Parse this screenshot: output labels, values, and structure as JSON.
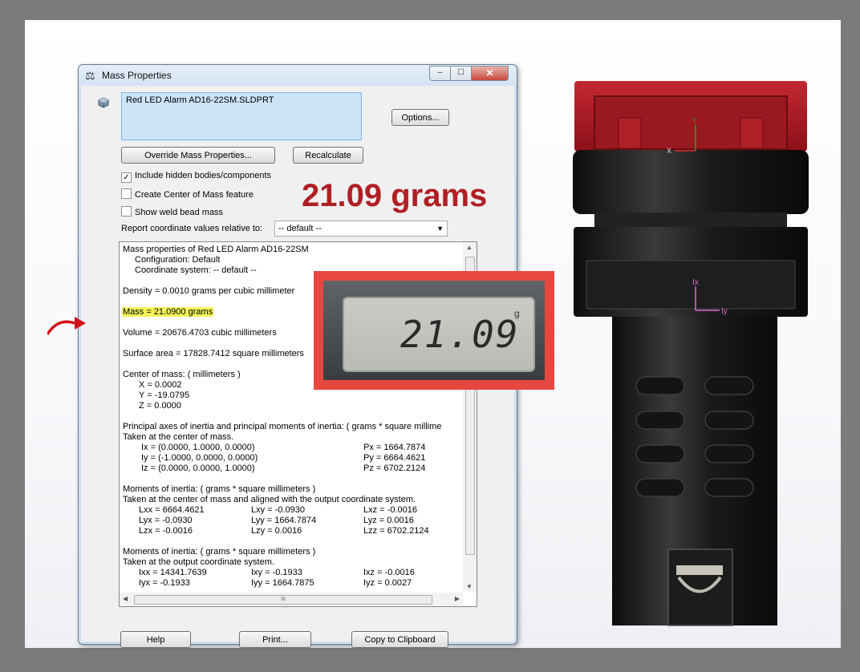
{
  "dialog": {
    "title": "Mass Properties",
    "title_buttons": {
      "minimize": "–",
      "maximize": "☐",
      "close": "✕"
    },
    "selection": "Red LED Alarm AD16-22SM.SLDPRT",
    "options_label": "Options...",
    "override_label": "Override Mass Properties...",
    "recalculate_label": "Recalculate",
    "checkboxes": [
      {
        "label": "Include hidden bodies/components",
        "checked": true,
        "mark": "✓"
      },
      {
        "label": "Create Center of Mass feature",
        "checked": false,
        "mark": ""
      },
      {
        "label": "Show weld bead mass",
        "checked": false,
        "mark": ""
      }
    ],
    "report_label": "Report coordinate values relative to:",
    "coord_value": "-- default --",
    "results": {
      "header": "Mass properties of Red LED Alarm AD16-22SM",
      "configuration": "Configuration: Default",
      "coordinate_system": "Coordinate system: -- default --",
      "density": "Density = 0.0010 grams per cubic millimeter",
      "mass": "Mass = 21.0900 grams",
      "volume": "Volume = 20676.4703 cubic millimeters",
      "surface_area": "Surface area = 17828.7412  square millimeters",
      "com_header": "Center of mass: ( millimeters )",
      "com_x": "X = 0.0002",
      "com_y": "Y = -19.0795",
      "com_z": "Z = 0.0000",
      "principal_header": "Principal axes of inertia and principal moments of inertia: ( grams *  square millime",
      "principal_taken": "Taken at the center of mass.",
      "ix": "Ix = (0.0000,  1.0000,  0.0000)",
      "iy": "Iy = (-1.0000,  0.0000,  0.0000)",
      "iz": "Iz = (0.0000,  0.0000,  1.0000)",
      "px": "Px = 1664.7874",
      "py": "Py = 6664.4621",
      "pz": "Pz = 6702.2124",
      "moi1_header": "Moments of inertia: ( grams *  square millimeters )",
      "moi1_taken": "Taken at the center of mass and aligned with the output coordinate system.",
      "lxx": "Lxx = 6664.4621",
      "lxy": "Lxy = -0.0930",
      "lxz": "Lxz = -0.0016",
      "lyx": "Lyx = -0.0930",
      "lyy": "Lyy = 1664.7874",
      "lyz": "Lyz = 0.0016",
      "lzx": "Lzx = -0.0016",
      "lzy": "Lzy = 0.0016",
      "lzz": "Lzz = 6702.2124",
      "moi2_header": "Moments of inertia: ( grams *  square millimeters )",
      "moi2_taken": "Taken at the output coordinate system.",
      "ixx": "Ixx = 14341.7639",
      "ixy": "Ixy = -0.1933",
      "ixz": "Ixz = -0.0016",
      "iyx": "Iyx = -0.1933",
      "iyy": "Iyy = 1664.7875",
      "iyz": "Iyz = 0.0027"
    },
    "help_label": "Help",
    "print_label": "Print...",
    "clipboard_label": "Copy to Clipboard"
  },
  "overlay": {
    "big_mass": "21.09 grams",
    "scale_reading": "21.09",
    "scale_unit": "g"
  },
  "model": {
    "axis_labels": {
      "x_top": "X",
      "y_top": "Y",
      "x_mid": "Ix",
      "y_mid": "Iy"
    }
  },
  "colors": {
    "big_mass_text": "#b01f24",
    "photo_frame": "#e8473f",
    "highlight": "#f4f35a",
    "model_red": "#a3171f",
    "model_black": "#1a1a1a"
  }
}
